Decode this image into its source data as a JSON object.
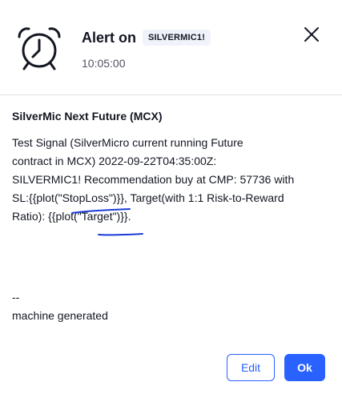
{
  "header": {
    "title": "Alert on",
    "symbol_badge": "SILVERMIC1!",
    "time": "10:05:00",
    "icon": "alarm-clock-icon",
    "close_icon": "close-icon"
  },
  "message": {
    "title": "SilverMic Next Future (MCX)",
    "body": "Test Signal (SilverMicro current running Future\ncontract in MCX) 2022-09-22T04:35:00Z:\nSILVERMIC1! Recommendation buy at CMP: 57736 with\nSL:{{plot(\"StopLoss\")}}, Target(with 1:1 Risk-to-Reward\nRatio): {{plot(\"Target\")}}.",
    "footer": "--\nmachine generated"
  },
  "buttons": {
    "edit": "Edit",
    "ok": "Ok"
  },
  "colors": {
    "accent": "#2962ff",
    "text": "#131722",
    "muted": "#50535e",
    "badge_bg": "#f0f3fa",
    "annotation": "#1a3bd6"
  }
}
